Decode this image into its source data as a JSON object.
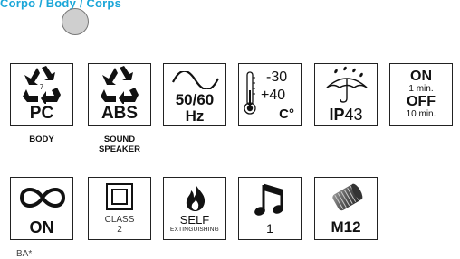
{
  "header": {
    "text": "Corpo / Body / Corps",
    "color": "#1aa6d8"
  },
  "swatch_color": "#cfcfcf",
  "row1": {
    "pc": {
      "icon": "recycle-icon",
      "code": "7",
      "label": "PC",
      "caption": "BODY"
    },
    "abs": {
      "icon": "recycle-icon",
      "label": "ABS",
      "caption_line1": "SOUND",
      "caption_line2": "SPEAKER"
    },
    "freq": {
      "icon": "sine-wave-icon",
      "line1": "50/60",
      "line2": "Hz"
    },
    "temp": {
      "icon": "thermometer-icon",
      "min": "-30",
      "max": "+40",
      "unit": "C°"
    },
    "ip": {
      "icon": "umbrella-rain-icon",
      "prefix": "IP",
      "rating": "43"
    },
    "timer": {
      "on_label": "ON",
      "on_time": "1 min.",
      "off_label": "OFF",
      "off_time": "10 min."
    }
  },
  "row2": {
    "infinite": {
      "icon": "infinity-icon",
      "label": "ON",
      "caption": "BA*"
    },
    "class2": {
      "icon": "double-square-icon",
      "line1": "CLASS",
      "line2": "2"
    },
    "self": {
      "icon": "flame-icon",
      "line1": "SELF",
      "line2": "EXTINGUISHING"
    },
    "melody": {
      "icon": "music-note-icon",
      "count": "1"
    },
    "gland": {
      "icon": "cable-gland-icon",
      "label": "M12"
    }
  }
}
